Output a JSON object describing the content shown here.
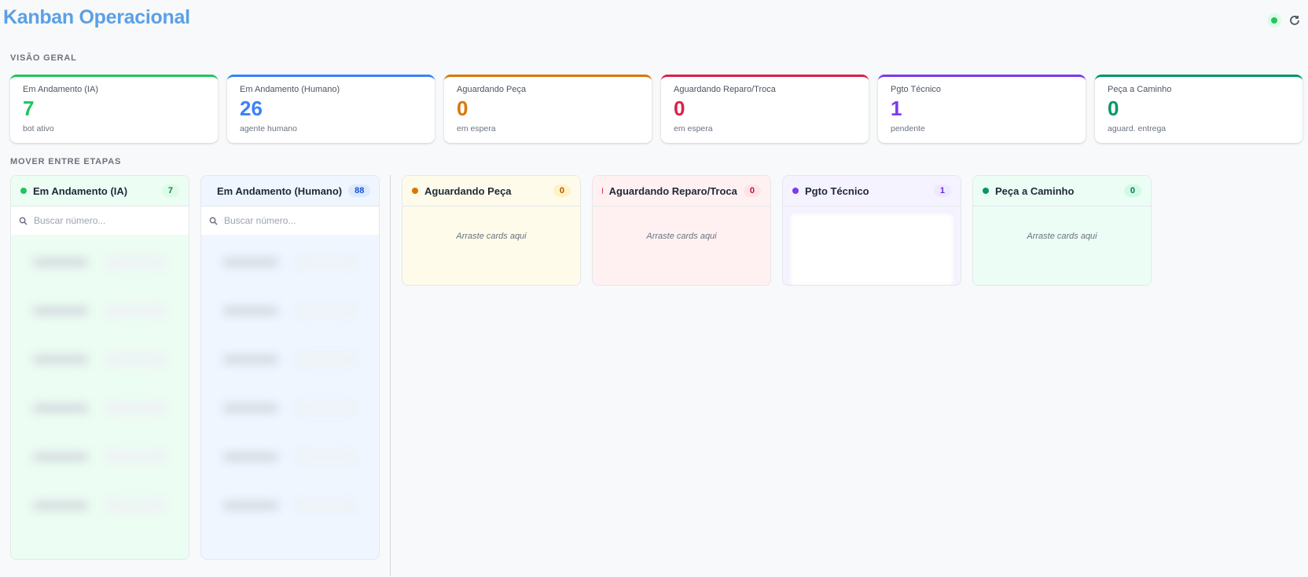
{
  "header": {
    "title": "Kanban Operacional",
    "status_icon": "online-dot",
    "refresh_icon": "refresh-icon"
  },
  "overview": {
    "label": "VISÃO GERAL",
    "cards": [
      {
        "title": "Em Andamento (IA)",
        "value": "7",
        "sub": "bot ativo",
        "color": "#22c55e"
      },
      {
        "title": "Em Andamento (Humano)",
        "value": "26",
        "sub": "agente humano",
        "color": "#3b82f6"
      },
      {
        "title": "Aguardando Peça",
        "value": "0",
        "sub": "em espera",
        "color": "#d97706"
      },
      {
        "title": "Aguardando Reparo/Troca",
        "value": "0",
        "sub": "em espera",
        "color": "#e11d48"
      },
      {
        "title": "Pgto Técnico",
        "value": "1",
        "sub": "pendente",
        "color": "#7c3aed"
      },
      {
        "title": "Peça a Caminho",
        "value": "0",
        "sub": "aguard. entrega",
        "color": "#059669"
      }
    ]
  },
  "board": {
    "label": "MOVER ENTRE ETAPAS",
    "search_placeholder": "Buscar número...",
    "empty_hint": "Arraste cards aqui",
    "columns": [
      {
        "name": "Em Andamento (IA)",
        "count": "7",
        "color": "#22c55e",
        "bg": "#ecfdf3",
        "badge_bg": "#dcfce7",
        "badge_color": "#15803d"
      },
      {
        "name": "Em Andamento (Humano)",
        "count": "88",
        "color": "#3b82f6",
        "bg": "#eff6ff",
        "badge_bg": "#dbeafe",
        "badge_color": "#1d4ed8"
      },
      {
        "name": "Aguardando Peça",
        "count": "0",
        "color": "#d97706",
        "bg": "#fefbea",
        "badge_bg": "#fef3c7",
        "badge_color": "#b45309"
      },
      {
        "name": "Aguardando Reparo/Troca",
        "count": "0",
        "color": "#e11d48",
        "bg": "#fff1f2",
        "badge_bg": "#ffe4e6",
        "badge_color": "#be123c"
      },
      {
        "name": "Pgto Técnico",
        "count": "1",
        "color": "#7c3aed",
        "bg": "#f5f3ff",
        "badge_bg": "#ede9fe",
        "badge_color": "#6d28d9"
      },
      {
        "name": "Peça a Caminho",
        "count": "0",
        "color": "#059669",
        "bg": "#ecfdf5",
        "badge_bg": "#d1fae5",
        "badge_color": "#047857"
      }
    ]
  }
}
